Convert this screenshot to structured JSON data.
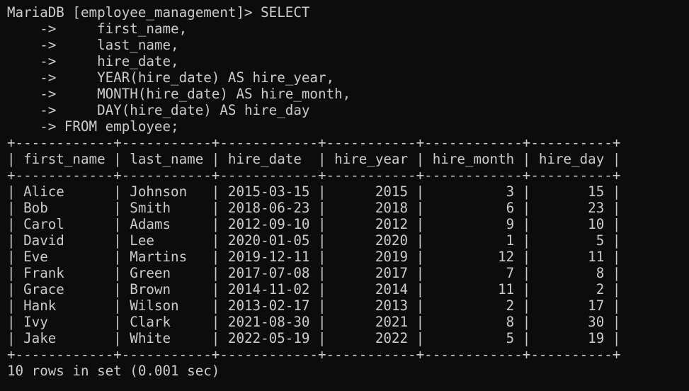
{
  "terminal": {
    "query_lines": [
      "MariaDB [employee_management]> SELECT",
      "    ->     first_name,",
      "    ->     last_name,",
      "    ->     hire_date,",
      "    ->     YEAR(hire_date) AS hire_year,",
      "    ->     MONTH(hire_date) AS hire_month,",
      "    ->     DAY(hire_date) AS hire_day",
      "    -> FROM employee;"
    ],
    "table": {
      "border": "+------------+-----------+------------+-----------+------------+----------+",
      "header": "| first_name | last_name | hire_date  | hire_year | hire_month | hire_day |",
      "rows": [
        "| Alice      | Johnson   | 2015-03-15 |      2015 |          3 |       15 |",
        "| Bob        | Smith     | 2018-06-23 |      2018 |          6 |       23 |",
        "| Carol      | Adams     | 2012-09-10 |      2012 |          9 |       10 |",
        "| David      | Lee       | 2020-01-05 |      2020 |          1 |        5 |",
        "| Eve        | Martins   | 2019-12-11 |      2019 |         12 |       11 |",
        "| Frank      | Green     | 2017-07-08 |      2017 |          7 |        8 |",
        "| Grace      | Brown     | 2014-11-02 |      2014 |         11 |        2 |",
        "| Hank       | Wilson    | 2013-02-17 |      2013 |          2 |       17 |",
        "| Ivy        | Clark     | 2021-08-30 |      2021 |          8 |       30 |",
        "| Jake       | White     | 2022-05-19 |      2022 |          5 |       19 |"
      ]
    },
    "footer": "10 rows in set (0.001 sec)"
  }
}
